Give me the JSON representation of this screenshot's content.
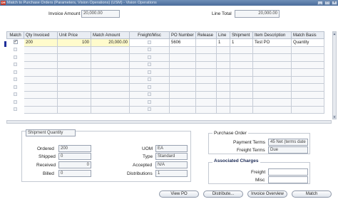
{
  "window": {
    "title": "Match to Purchase Orders (Parameters, Vision Operations) (USM) - Vision Operations",
    "icon_text": "OR",
    "controls": [
      "minimize-icon",
      "maximize-icon",
      "close-icon"
    ]
  },
  "header": {
    "invoice_amount_label": "Invoice Amount",
    "invoice_amount_value": "20,000.00",
    "line_total_label": "Line Total",
    "line_total_value": "20,000.00"
  },
  "grid": {
    "columns": [
      "Match",
      "Qty Invoiced",
      "Unit Price",
      "Match Amount",
      "Freight/Misc",
      "PO Number",
      "Release",
      "Line",
      "Shipment",
      "Item Description",
      "Match Basis"
    ],
    "rows": [
      {
        "match": "✓",
        "qty_invoiced": "200",
        "unit_price": "100",
        "match_amount": "20,000.00",
        "freight_misc": "",
        "po_number": "5606",
        "release": "",
        "line": "1",
        "shipment": "1",
        "item_description": "Test PO",
        "match_basis": "Quantity"
      }
    ],
    "empty_rows": 9
  },
  "shipment": {
    "tab_label": "Shipment Quantity",
    "ordered_label": "Ordered",
    "ordered_value": "200",
    "shipped_label": "Shipped",
    "shipped_value": "0",
    "received_label": "Received",
    "received_value": "0",
    "billed_label": "Billed",
    "billed_value": "0",
    "uom_label": "UOM",
    "uom_value": "EA",
    "type_label": "Type",
    "type_value": "Standard",
    "accepted_label": "Accepted",
    "accepted_value": "N/A",
    "distributions_label": "Distributions",
    "distributions_value": "1"
  },
  "purchase_order": {
    "title": "Purchase Order",
    "payment_terms_label": "Payment Terms",
    "payment_terms_value": "45 Net (terms date",
    "freight_terms_label": "Freight Terms",
    "freight_terms_value": "Due"
  },
  "associated_charges": {
    "title": "Associated Charges",
    "freight_label": "Freight",
    "freight_value": "",
    "misc_label": "Misc",
    "misc_value": ""
  },
  "buttons": {
    "view_po": "View PO",
    "distribute": "Distribute...",
    "invoice_overview": "Invoice Overview",
    "match": "Match"
  },
  "colors": {
    "title_bar": "#4a6c9a",
    "selected_row_fields": "#fffbcc",
    "row_marker": "#1f2f9a",
    "section_header": "#1b2a55"
  }
}
